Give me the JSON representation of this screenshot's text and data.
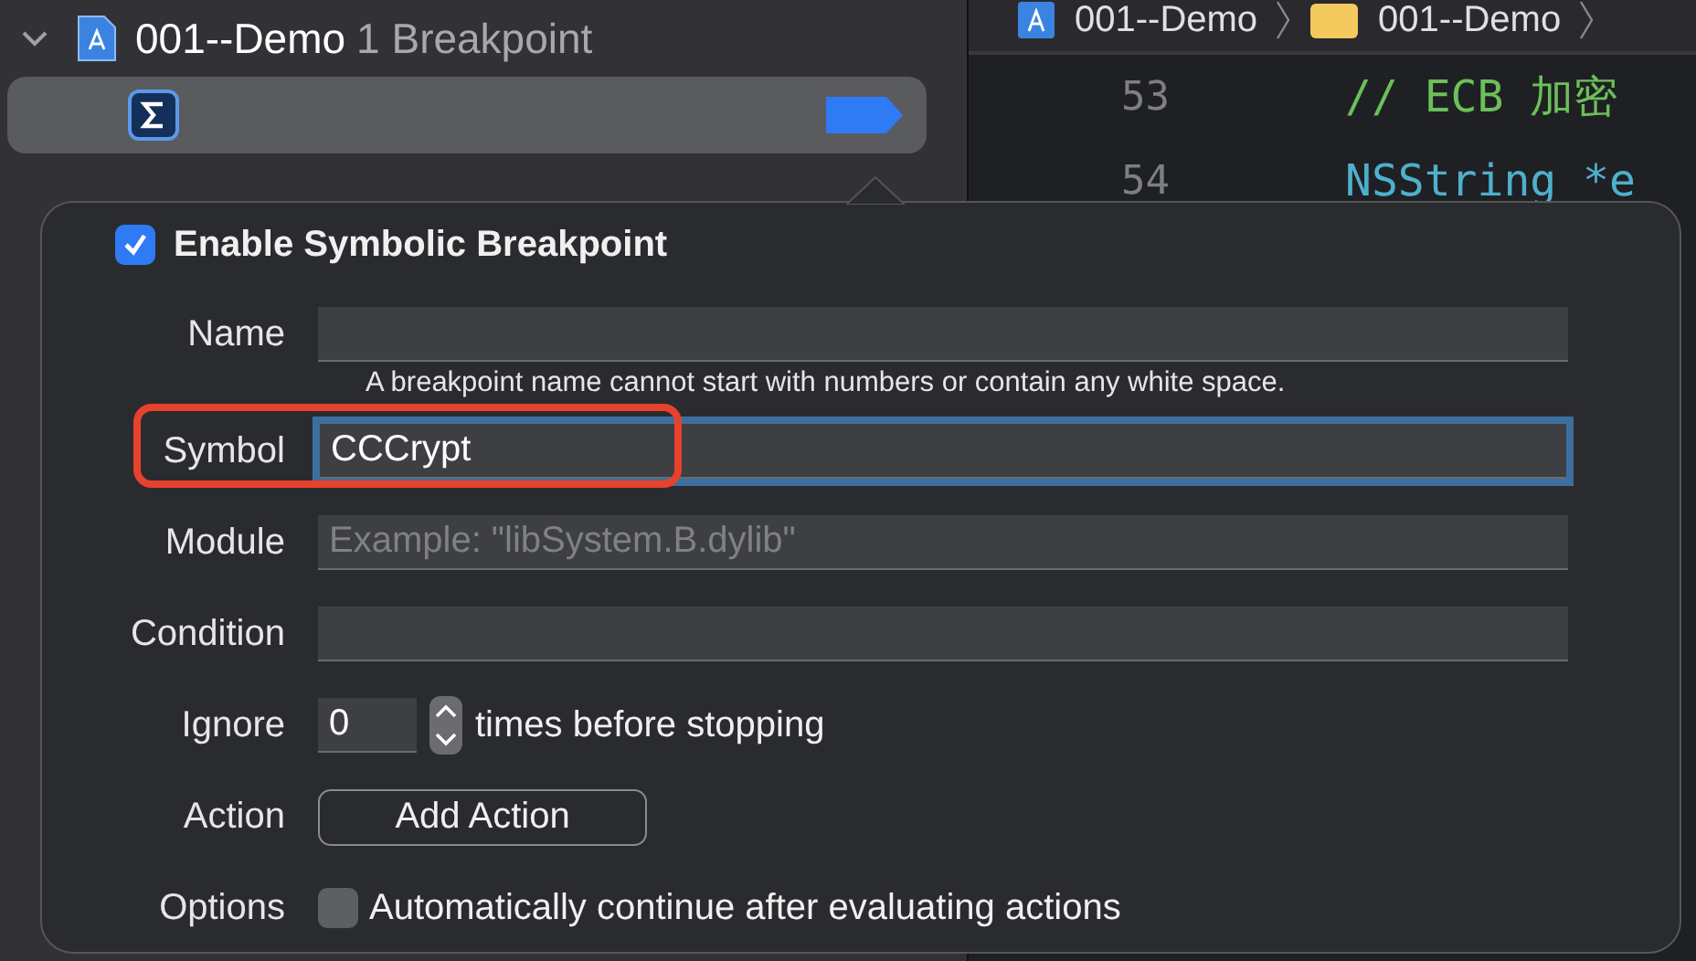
{
  "navigator": {
    "project": {
      "name": "001--Demo",
      "count": "1 Breakpoint",
      "expanded": true
    },
    "breakpoint": {
      "selected": true,
      "enabled": true
    }
  },
  "breadcrumb": [
    {
      "kind": "project",
      "label": "001--Demo"
    },
    {
      "kind": "folder",
      "label": "001--Demo"
    }
  ],
  "editor": {
    "lines": [
      {
        "number": "53",
        "kind": "comment",
        "text": "// ECB 加密"
      },
      {
        "number": "54",
        "kind": "code",
        "text": "NSString *e"
      }
    ]
  },
  "popover": {
    "enable": {
      "label": "Enable Symbolic Breakpoint",
      "checked": true
    },
    "rows": [
      {
        "kind": "text",
        "label": "Name",
        "value": "",
        "hint": "A breakpoint name cannot start with numbers or contain any white space."
      },
      {
        "kind": "text",
        "label": "Symbol",
        "value": "CCCrypt",
        "focused": true,
        "highlighted": true
      },
      {
        "kind": "text",
        "label": "Module",
        "placeholder": "Example: \"libSystem.B.dylib\""
      },
      {
        "kind": "text",
        "label": "Condition",
        "value": ""
      },
      {
        "kind": "stepper",
        "label": "Ignore",
        "value": "0",
        "suffix": "times before stopping"
      },
      {
        "kind": "button",
        "label": "Action",
        "button": "Add Action"
      },
      {
        "kind": "checkbox",
        "label": "Options",
        "checked": false,
        "text": "Automatically continue after evaluating actions"
      }
    ]
  }
}
